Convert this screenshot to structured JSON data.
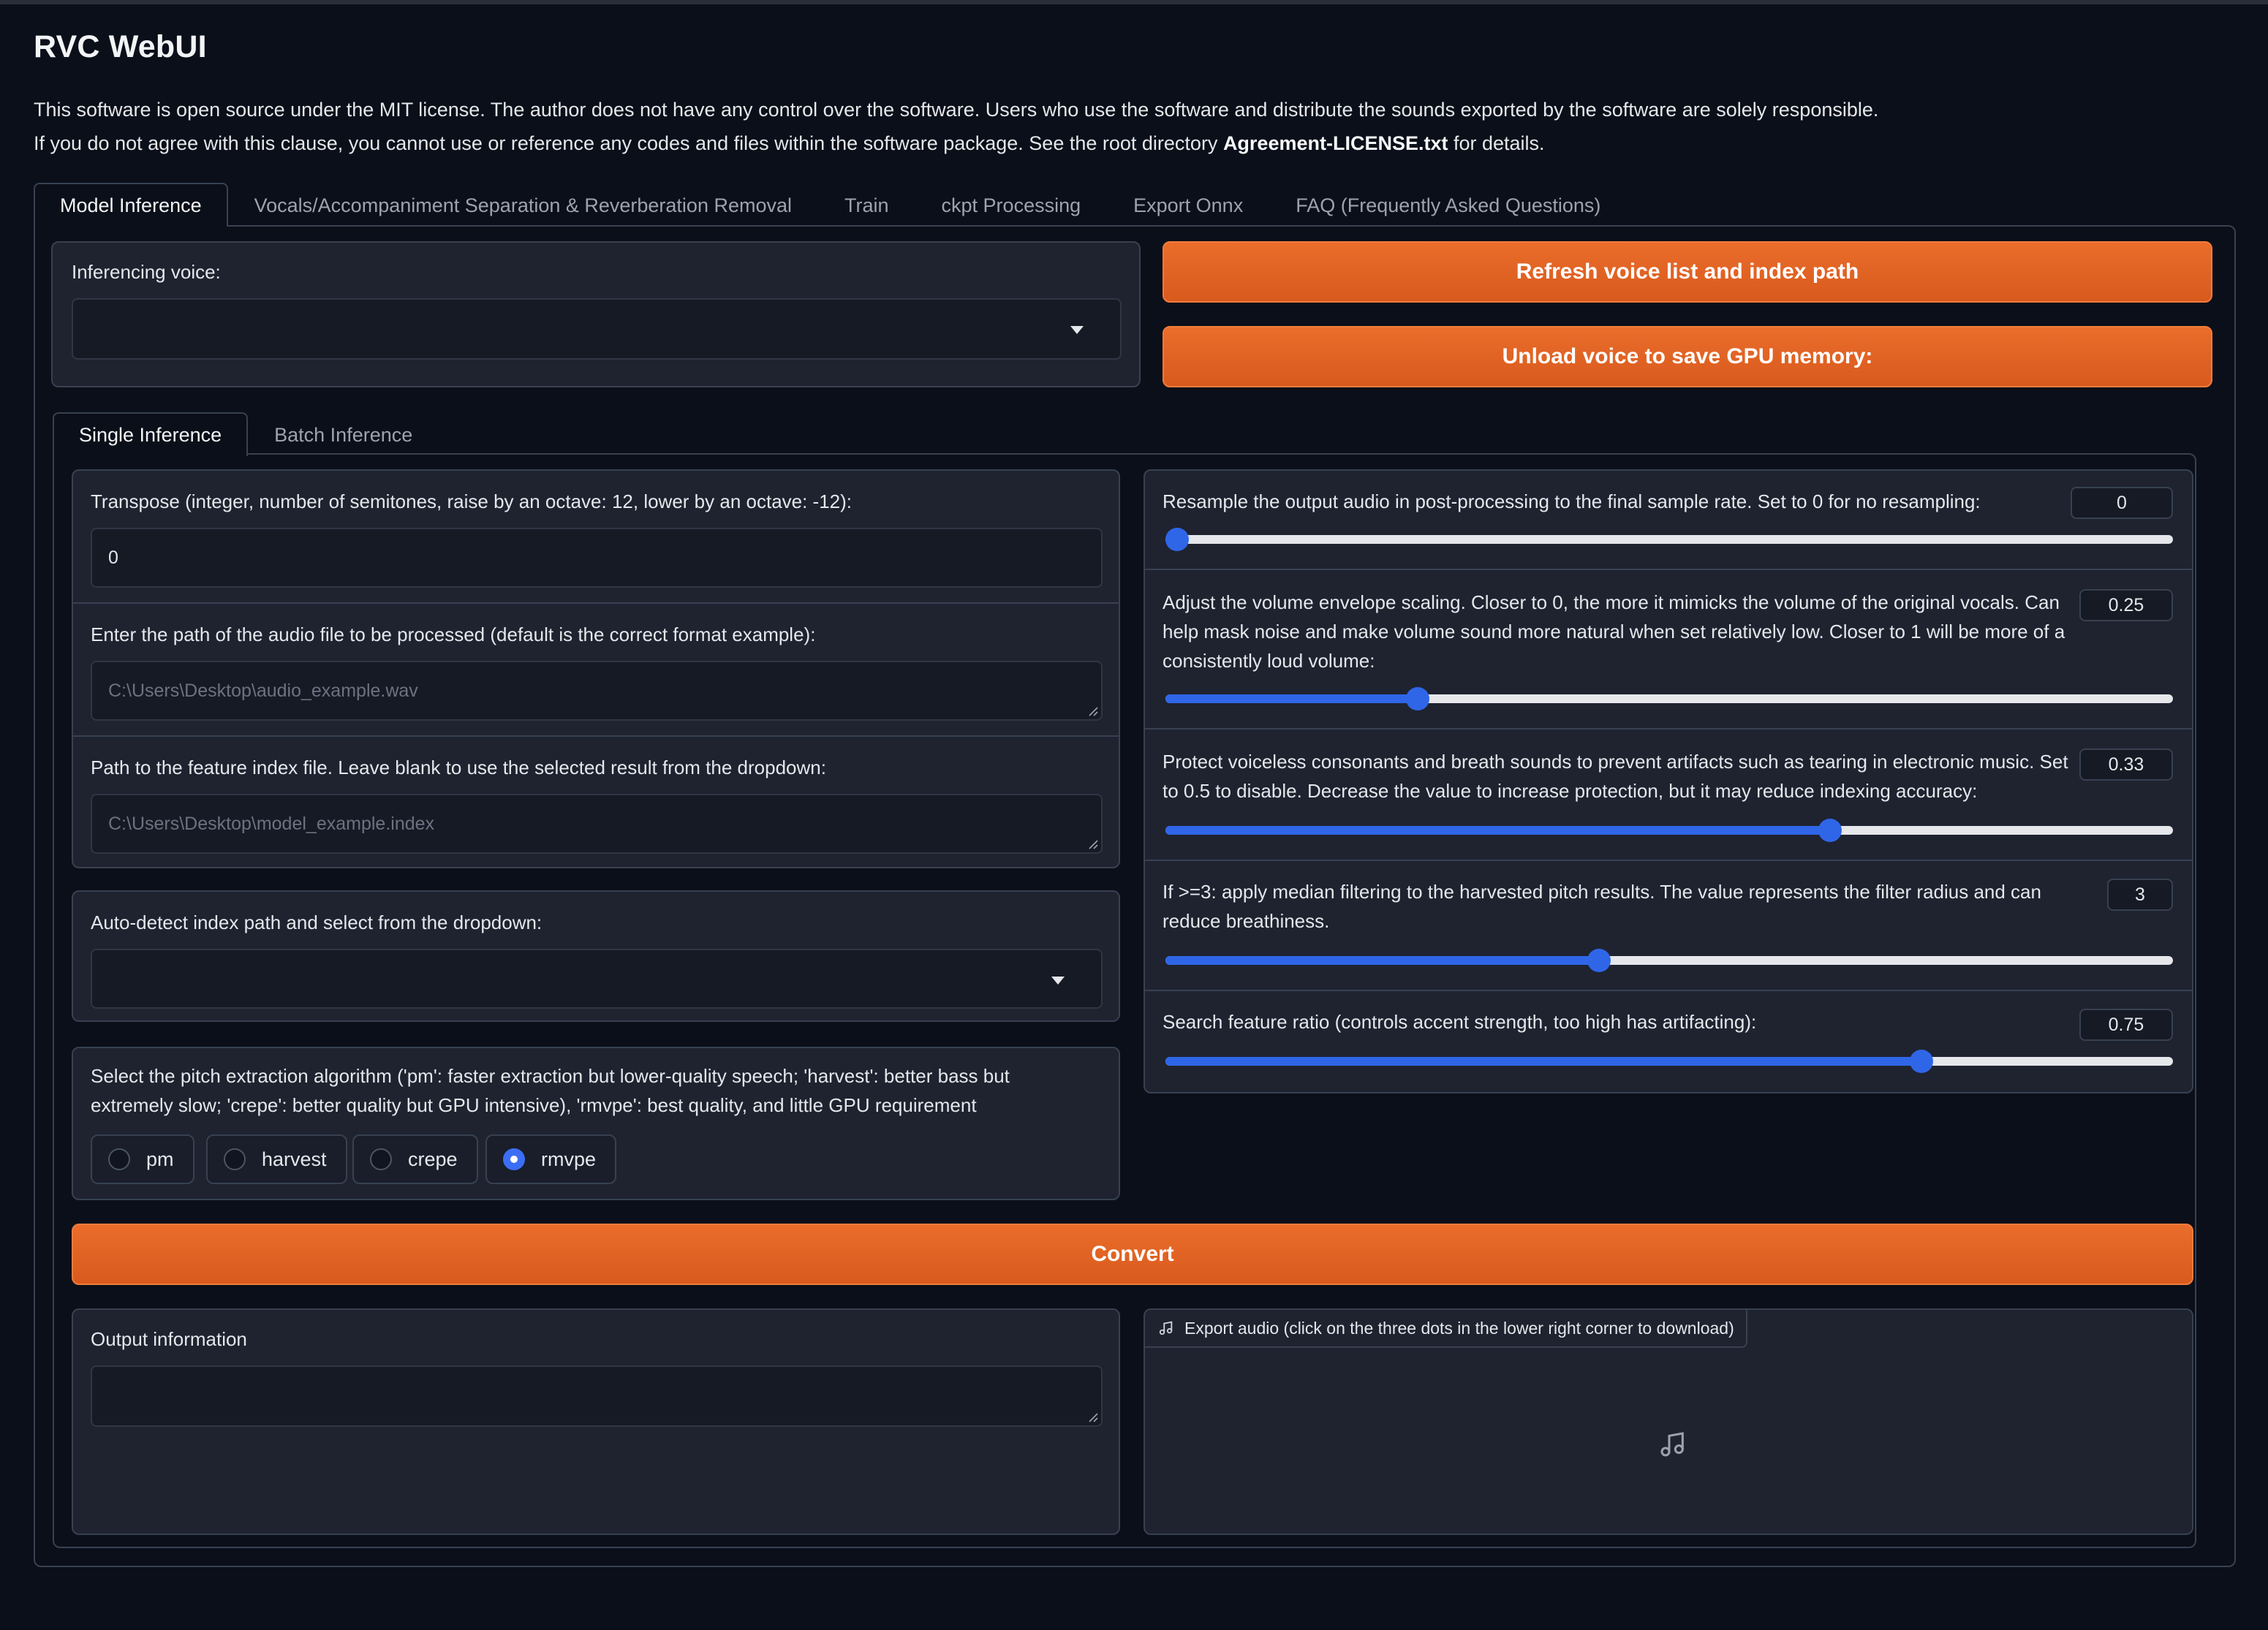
{
  "app": {
    "title": "RVC WebUI",
    "desc_line1": "This software is open source under the MIT license. The author does not have any control over the software. Users who use the software and distribute the sounds exported by the software are solely responsible.",
    "desc_line2_pre": "If you do not agree with this clause, you cannot use or reference any codes and files within the software package. See the root directory ",
    "desc_line2_bold": "Agreement-LICENSE.txt",
    "desc_line2_post": " for details."
  },
  "main_tabs": [
    {
      "label": "Model Inference",
      "active": true
    },
    {
      "label": "Vocals/Accompaniment Separation & Reverberation Removal"
    },
    {
      "label": "Train"
    },
    {
      "label": "ckpt Processing"
    },
    {
      "label": "Export Onnx"
    },
    {
      "label": "FAQ (Frequently Asked Questions)"
    }
  ],
  "voice": {
    "label": "Inferencing voice:",
    "value": "",
    "refresh_button": "Refresh voice list and index path",
    "unload_button": "Unload voice to save GPU memory:"
  },
  "sub_tabs": [
    {
      "label": "Single Inference",
      "active": true
    },
    {
      "label": "Batch Inference"
    }
  ],
  "left": {
    "transpose_label": "Transpose (integer, number of semitones, raise by an octave: 12, lower by an octave: -12):",
    "transpose_value": "0",
    "audio_path_label": "Enter the path of the audio file to be processed (default is the correct format example):",
    "audio_path_placeholder": "C:\\Users\\Desktop\\audio_example.wav",
    "index_path_label": "Path to the feature index file. Leave blank to use the selected result from the dropdown:",
    "index_path_placeholder": "C:\\Users\\Desktop\\model_example.index",
    "auto_index_label": "Auto-detect index path and select from the dropdown:",
    "auto_index_value": "",
    "pitch_label_line1": "Select the pitch extraction algorithm ('pm': faster extraction but lower-quality speech; 'harvest': better bass but",
    "pitch_label_line2": "extremely slow; 'crepe': better quality but GPU intensive), 'rmvpe': best quality, and little GPU requirement",
    "pitch_options": [
      "pm",
      "harvest",
      "crepe",
      "rmvpe"
    ],
    "pitch_selected": "rmvpe"
  },
  "right": {
    "resample": {
      "line1": "Resample the output audio in post-processing to the final sample rate. Set to 0 for no resampling:",
      "value": "0",
      "fraction": 0.0
    },
    "rms": {
      "line1": "Adjust the volume envelope scaling. Closer to 0, the more it mimicks the volume of the original vocals. Can",
      "line2": "help mask noise and make volume sound more natural when set relatively low. Closer to 1 will be more of a",
      "line3": "consistently loud volume:",
      "value": "0.25",
      "fraction": 0.25
    },
    "protect": {
      "line1": "Protect voiceless consonants and breath sounds to prevent artifacts such as tearing in electronic music. Set",
      "line2": "to 0.5 to disable. Decrease the value to increase protection, but it may reduce indexing accuracy:",
      "value": "0.33",
      "fraction": 0.66
    },
    "filter": {
      "line1": "If >=3: apply median filtering to the harvested pitch results. The value represents the filter radius and can",
      "line2": "reduce breathiness.",
      "value": "3",
      "fraction": 0.43
    },
    "index_rate": {
      "line1": "Search feature ratio (controls accent strength, too high has artifacting):",
      "value": "0.75",
      "fraction": 0.75
    }
  },
  "convert_button": "Convert",
  "output": {
    "info_label": "Output information",
    "info_value": "",
    "audio_label": "Export audio (click on the three dots in the lower right corner to download)"
  },
  "colors": {
    "accent": "#2f66e8",
    "button": "#e4662a",
    "background": "#0b0f19"
  }
}
